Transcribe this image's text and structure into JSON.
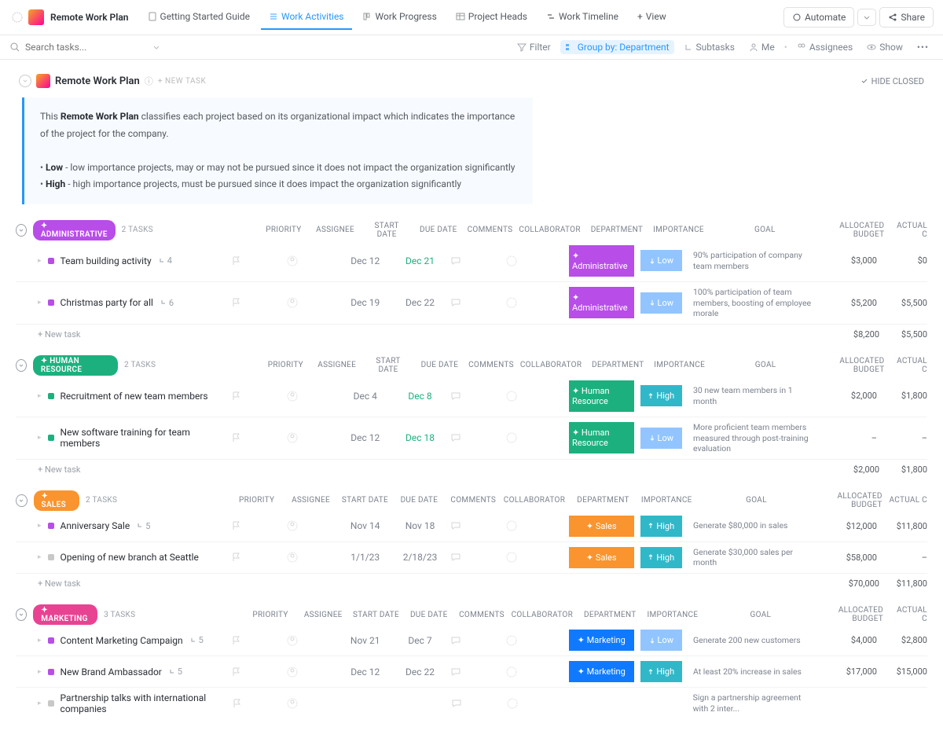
{
  "header": {
    "title": "Remote Work Plan",
    "views": [
      {
        "label": "Getting Started Guide"
      },
      {
        "label": "Work Activities"
      },
      {
        "label": "Work Progress"
      },
      {
        "label": "Project Heads"
      },
      {
        "label": "Work Timeline"
      },
      {
        "label": "View"
      }
    ],
    "automate": "Automate",
    "share": "Share"
  },
  "toolbar": {
    "search_placeholder": "Search tasks...",
    "filter": "Filter",
    "group_by": "Group by: Department",
    "subtasks": "Subtasks",
    "me": "Me",
    "assignees": "Assignees",
    "show": "Show"
  },
  "page": {
    "title": "Remote Work Plan",
    "new_task": "+ NEW TASK",
    "hide_closed": "HIDE CLOSED",
    "description_intro_a": "This ",
    "description_intro_b": "Remote Work Plan",
    "description_intro_c": " classifies each project based on its organizational impact which indicates the importance of the project for the company.",
    "desc_low_label": "Low",
    "desc_low_text": " - low importance projects, may or may not be pursued since it does not impact the organization significantly",
    "desc_high_label": "High",
    "desc_high_text": " - high importance projects, must be pursued since it does impact the organization significantly"
  },
  "columns": {
    "priority": "PRIORITY",
    "assignee": "ASSIGNEE",
    "start": "START DATE",
    "due": "DUE DATE",
    "comments": "COMMENTS",
    "collab": "COLLABORATOR",
    "dept": "DEPARTMENT",
    "importance": "IMPORTANCE",
    "goal": "GOAL",
    "budget": "ALLOCATED BUDGET",
    "actual": "ACTUAL C"
  },
  "groups": [
    {
      "name": "Administrative",
      "css": "admin",
      "count": "2 TASKS",
      "tasks": [
        {
          "name": "Team building activity",
          "subs": "4",
          "start": "Dec 12",
          "due": "Dec 21",
          "due_cls": "green-date",
          "dept": "Administrative",
          "imp": "Low",
          "imp_cls": "low",
          "goal": "90% participation of company team members",
          "budget": "$3,000",
          "actual": "$0",
          "sq": "purple"
        },
        {
          "name": "Christmas party for all",
          "subs": "6",
          "start": "Dec 19",
          "due": "Dec 22",
          "due_cls": "",
          "dept": "Administrative",
          "imp": "Low",
          "imp_cls": "low",
          "goal": "100% participation of team members, boosting of employee morale",
          "budget": "$5,200",
          "actual": "$5,500",
          "sq": "purple"
        }
      ],
      "total_budget": "$8,200",
      "total_actual": "$5,500"
    },
    {
      "name": "Human Resource",
      "css": "hr",
      "count": "2 TASKS",
      "tasks": [
        {
          "name": "Recruitment of new team members",
          "subs": "",
          "start": "Dec 4",
          "due": "Dec 8",
          "due_cls": "green-date",
          "dept": "Human Resource",
          "imp": "High",
          "imp_cls": "high",
          "goal": "30 new team members in 1 month",
          "budget": "$2,000",
          "actual": "$1,800",
          "sq": "green"
        },
        {
          "name": "New software training for team members",
          "subs": "",
          "start": "Dec 12",
          "due": "Dec 18",
          "due_cls": "green-date",
          "dept": "Human Resource",
          "imp": "Low",
          "imp_cls": "low",
          "goal": "More proficient team members measured through post-training evaluation",
          "budget": "–",
          "actual": "–",
          "sq": "green"
        }
      ],
      "total_budget": "$2,000",
      "total_actual": "$1,800"
    },
    {
      "name": "Sales",
      "css": "sales",
      "count": "2 TASKS",
      "tasks": [
        {
          "name": "Anniversary Sale",
          "subs": "5",
          "start": "Nov 14",
          "due": "Nov 18",
          "due_cls": "",
          "dept": "Sales",
          "imp": "High",
          "imp_cls": "high",
          "goal": "Generate $80,000 in sales",
          "budget": "$12,000",
          "actual": "$11,800",
          "sq": "purple"
        },
        {
          "name": "Opening of new branch at Seattle",
          "subs": "",
          "start": "1/1/23",
          "due": "2/18/23",
          "due_cls": "",
          "dept": "Sales",
          "imp": "High",
          "imp_cls": "high",
          "goal": "Generate $30,000 sales per month",
          "budget": "$58,000",
          "actual": "–",
          "sq": "grey"
        }
      ],
      "total_budget": "$70,000",
      "total_actual": "$11,800"
    },
    {
      "name": "Marketing",
      "css": "mkt",
      "count": "3 TASKS",
      "tasks": [
        {
          "name": "Content Marketing Campaign",
          "subs": "5",
          "start": "Nov 21",
          "due": "Dec 7",
          "due_cls": "",
          "dept": "Marketing",
          "imp": "Low",
          "imp_cls": "low",
          "goal": "Generate 200 new customers",
          "budget": "$4,000",
          "actual": "$2,800",
          "sq": "purple"
        },
        {
          "name": "New Brand Ambassador",
          "subs": "5",
          "start": "Dec 12",
          "due": "Dec 22",
          "due_cls": "",
          "dept": "Marketing",
          "imp": "High",
          "imp_cls": "high",
          "goal": "At least 20% increase in sales",
          "budget": "$17,000",
          "actual": "$15,000",
          "sq": "purple"
        },
        {
          "name": "Partnership talks with international companies",
          "subs": "",
          "start": "",
          "due": "",
          "due_cls": "",
          "dept": "",
          "imp": "",
          "imp_cls": "",
          "goal": "Sign a partnership agreement with 2 inter...",
          "budget": "",
          "actual": "",
          "sq": "grey"
        }
      ],
      "total_budget": "",
      "total_actual": ""
    }
  ],
  "new_task_label": "+ New task"
}
